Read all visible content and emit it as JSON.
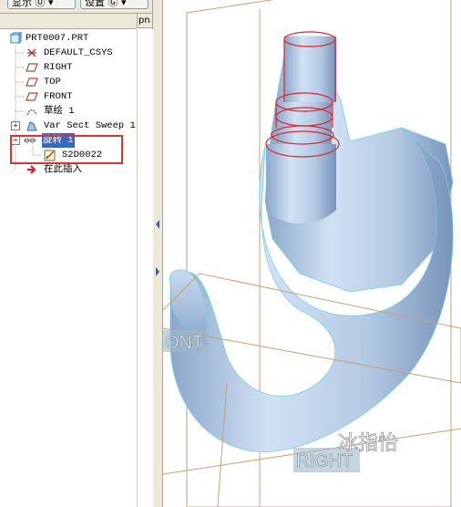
{
  "toolbar": {
    "show_button": "显示 Ⓤ ▾",
    "settings_button": "设置 Ⓖ ▾"
  },
  "tree_header_right": "pn",
  "tree": {
    "root": "PRT0007.PRT",
    "items": [
      {
        "label": "DEFAULT_CSYS"
      },
      {
        "label": "RIGHT"
      },
      {
        "label": "TOP"
      },
      {
        "label": "FRONT"
      },
      {
        "label": "草绘 1"
      },
      {
        "label": "Var Sect Sweep 1"
      },
      {
        "label": "旋转 1"
      },
      {
        "label": "S2D0022"
      },
      {
        "label": "在此插入"
      }
    ]
  },
  "viewport": {
    "datum_front_label": "ONT",
    "datum_right_label": "RIGHT",
    "watermark": "冰指怡"
  },
  "colors": {
    "model_fill": "#b9cfe8",
    "edge_red": "#e8202a",
    "datum_plane": "#c8a070",
    "selection": "#316ac5"
  }
}
